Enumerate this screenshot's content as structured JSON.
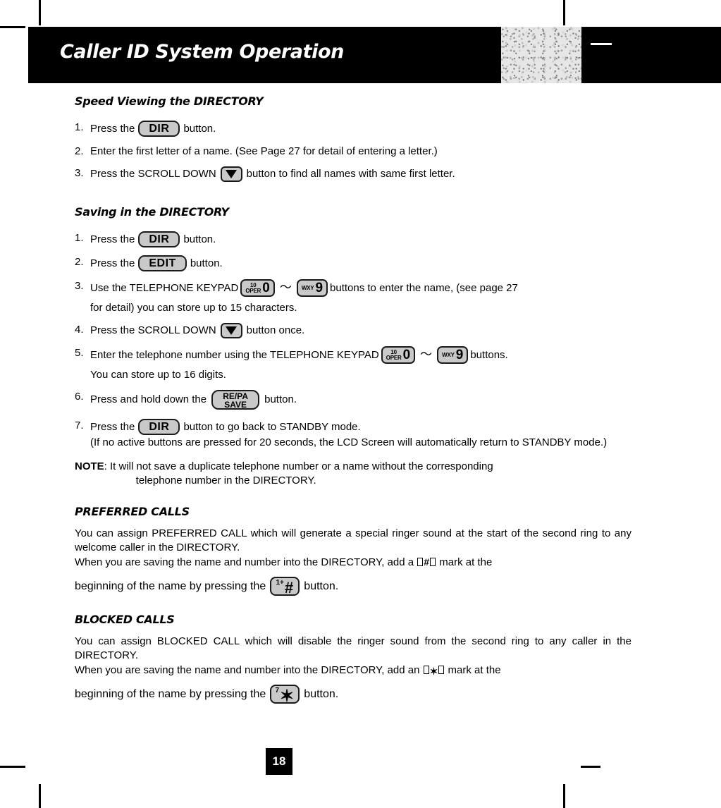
{
  "header": {
    "title": "Caller ID System Operation",
    "swatch_name": "texture-swatch",
    "dash_name": "white-dash"
  },
  "sections": [
    {
      "id": "speed-viewing",
      "heading": "Speed Viewing the DIRECTORY",
      "steps": [
        {
          "num": "1.",
          "parts": [
            {
              "type": "text",
              "value": "Press the"
            },
            {
              "type": "button",
              "style": "pill",
              "label": "DIR"
            },
            {
              "type": "text",
              "value": "button."
            }
          ]
        },
        {
          "num": "2.",
          "parts": [
            {
              "type": "text",
              "value": "Enter the first letter of a name. (See Page 27 for detail of entering a letter.)"
            }
          ]
        },
        {
          "num": "3.",
          "parts": [
            {
              "type": "text",
              "value": "Press the SCROLL DOWN"
            },
            {
              "type": "button",
              "style": "arrow-down",
              "label": "▼"
            },
            {
              "type": "text",
              "value": "button to find all names with same first letter."
            }
          ]
        }
      ]
    },
    {
      "id": "saving",
      "heading": "Saving in the DIRECTORY",
      "steps": [
        {
          "num": "1.",
          "parts": [
            {
              "type": "text",
              "value": "Press the"
            },
            {
              "type": "button",
              "style": "pill",
              "label": "DIR"
            },
            {
              "type": "text",
              "value": "button."
            }
          ]
        },
        {
          "num": "2.",
          "parts": [
            {
              "type": "text",
              "value": "Press the"
            },
            {
              "type": "button",
              "style": "pill",
              "label": "EDIT"
            },
            {
              "type": "text",
              "value": "button."
            }
          ]
        },
        {
          "num": "3.",
          "parts": [
            {
              "type": "text",
              "value": "Use the TELEPHONE KEYPAD"
            },
            {
              "type": "key",
              "top": "10",
              "bottom": "OPER",
              "digit": "0"
            },
            {
              "type": "tilde",
              "value": "～"
            },
            {
              "type": "key",
              "top": "",
              "bottom": "WXY",
              "digit": "9"
            },
            {
              "type": "text",
              "value": "buttons to enter the name, (see page 27"
            }
          ],
          "cont": "for detail) you can store up to 15 characters."
        },
        {
          "num": "4.",
          "parts": [
            {
              "type": "text",
              "value": "Press the SCROLL DOWN"
            },
            {
              "type": "button",
              "style": "arrow-down",
              "label": "▼"
            },
            {
              "type": "text",
              "value": "button once."
            }
          ]
        },
        {
          "num": "5.",
          "parts": [
            {
              "type": "text",
              "value": "Enter the telephone number using the TELEPHONE KEYPAD"
            },
            {
              "type": "key",
              "top": "10",
              "bottom": "OPER",
              "digit": "0"
            },
            {
              "type": "tilde",
              "value": "～"
            },
            {
              "type": "key",
              "top": "",
              "bottom": "WXY",
              "digit": "9"
            },
            {
              "type": "text",
              "value": "buttons."
            }
          ],
          "cont": "You can store up to 16 digits."
        },
        {
          "num": "6.",
          "parts": [
            {
              "type": "text",
              "value": "Press and hold down the"
            },
            {
              "type": "button",
              "style": "two-line",
              "line1": "RE/PA",
              "line2": "SAVE"
            },
            {
              "type": "text",
              "value": "button."
            }
          ]
        },
        {
          "num": "7.",
          "parts": [
            {
              "type": "text",
              "value": "Press the"
            },
            {
              "type": "button",
              "style": "pill",
              "label": "DIR"
            },
            {
              "type": "text",
              "value": "button to go back to STANDBY mode."
            }
          ]
        }
      ],
      "parenthetical": "(If no active buttons are pressed for 20 seconds, the LCD Screen will automatically return to STANDBY mode.)",
      "note": {
        "label": "NOTE",
        "line1": ": It will not save a duplicate telephone number or a name without the corresponding",
        "line2": "telephone number in the DIRECTORY."
      }
    }
  ],
  "preferred_calls": {
    "heading": "PREFERRED CALLS",
    "p1": "You can assign PREFERRED CALL which will generate a special ringer sound at the start of the second ring to any welcome caller in the DIRECTORY.",
    "p2_before": "When you are saving the name and number into the DIRECTORY, add a",
    "p2_symbol": "#",
    "p2_after": "mark at the",
    "p3_before": "beginning of the name by pressing the",
    "p3_after": "button.",
    "button": {
      "sup": "1+",
      "sym": "#"
    }
  },
  "blocked_calls": {
    "heading": "BLOCKED CALLS",
    "p1": "You can assign BLOCKED CALL which will disable the ringer sound from the second ring to any caller in the DIRECTORY.",
    "p2_before": "When you are saving the name and number into the DIRECTORY, add an",
    "p2_symbol": "✶",
    "p2_after": "mark at the",
    "p3_before": "beginning of the name by pressing the",
    "p3_after": "button.",
    "button": {
      "sup": "7",
      "sym": "✶"
    }
  },
  "footer": {
    "page_number": "18"
  }
}
